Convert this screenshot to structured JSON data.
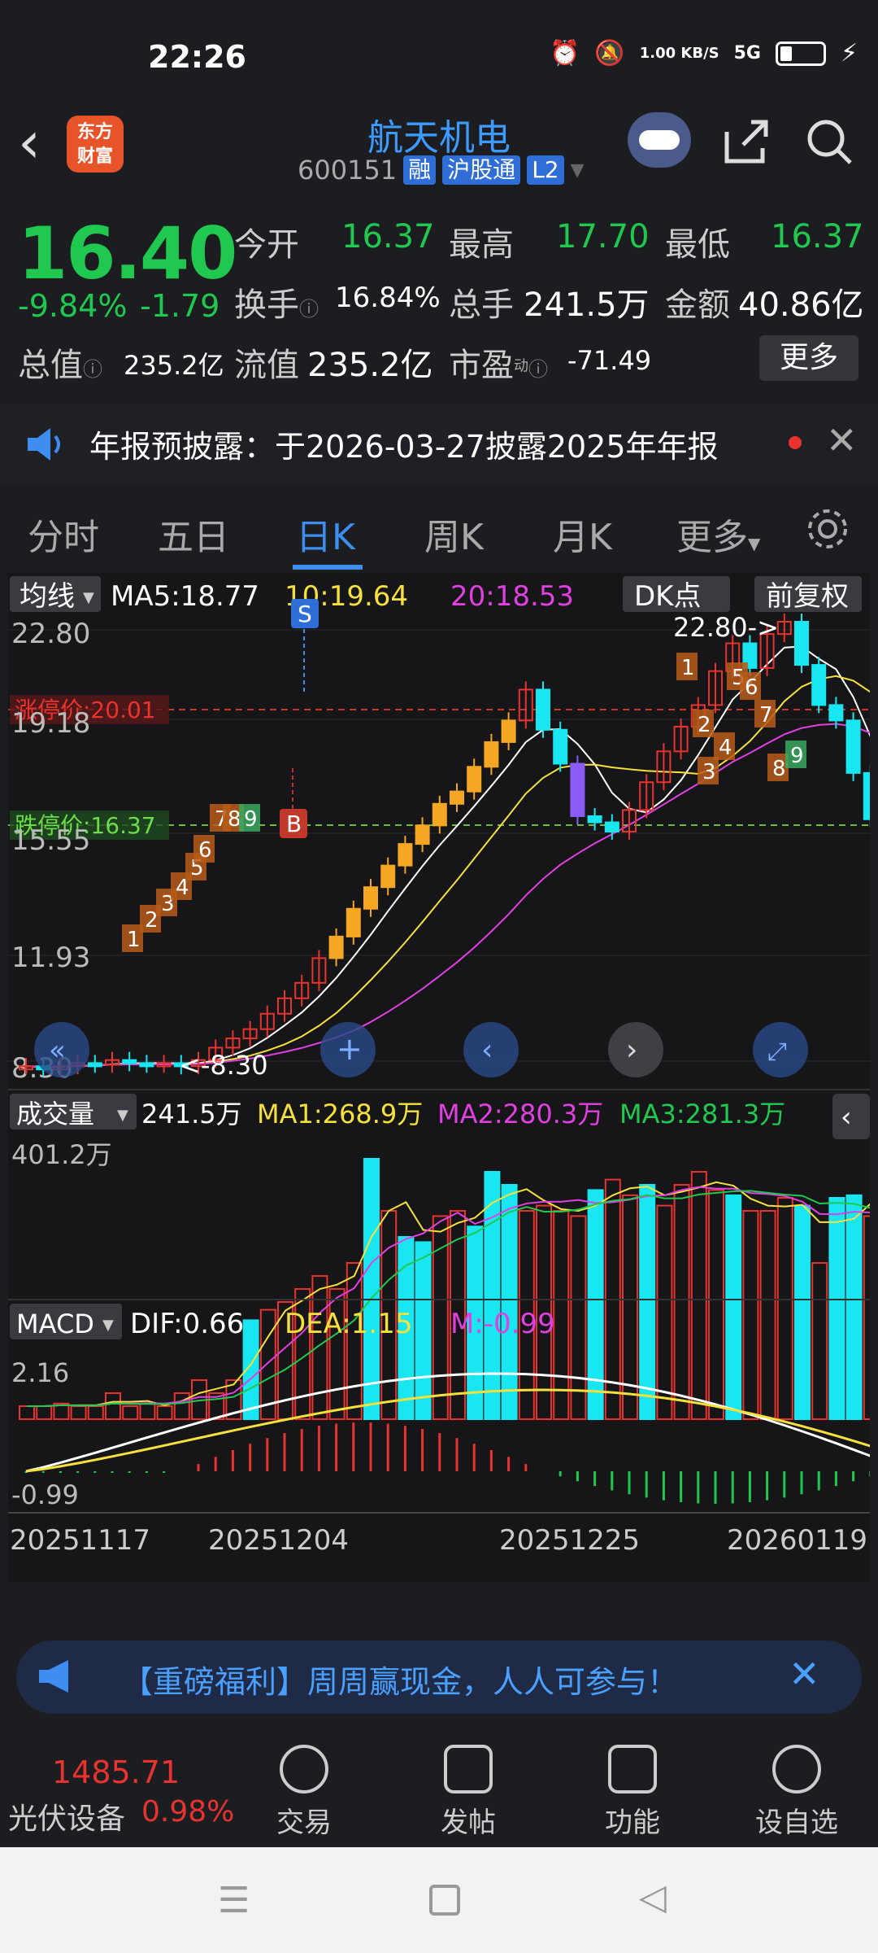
{
  "status_bar": {
    "time": "22:26",
    "net_speed": "1.00 KB/S",
    "signal": "5G"
  },
  "header": {
    "logo_line1": "东方",
    "logo_line2": "财富",
    "stock_name": "航天机电",
    "stock_code": "600151",
    "tag1": "融",
    "tag2": "沪股通",
    "tag3": "L2"
  },
  "quote": {
    "price": "16.40",
    "change_pct": "-9.84%",
    "change": "-1.79",
    "open_label": "今开",
    "open": "16.37",
    "high_label": "最高",
    "high": "17.70",
    "low_label": "最低",
    "low": "16.37",
    "turnover_label": "换手",
    "turnover": "16.84%",
    "volume_label": "总手",
    "volume": "241.5万",
    "amount_label": "金额",
    "amount": "40.86亿",
    "mktcap_label": "总值",
    "mktcap": "235.2亿",
    "float_label": "流值",
    "float": "235.2亿",
    "pe_label": "市盈",
    "pe_sup": "动",
    "pe": "-71.49",
    "more": "更多"
  },
  "notice": {
    "text": "年报预披露：于2026-03-27披露2025年年报"
  },
  "tabs": [
    "分时",
    "五日",
    "日K",
    "周K",
    "月K",
    "更多"
  ],
  "active_tab": "日K",
  "kline": {
    "indicator": "均线",
    "ma5": "MA5:18.77",
    "ma10": "10:19.64",
    "ma20": "20:18.53",
    "dk": "DK点",
    "adjust": "前复权",
    "y_labels": [
      "22.80",
      "19.18",
      "15.55",
      "11.93",
      "8.30"
    ],
    "limit_up": "涨停价:20.01",
    "limit_down": "跌停价:16.37",
    "max_label": "22.80->",
    "min_label": "<-8.30",
    "s_marker": "S",
    "b_marker": "B"
  },
  "volume_panel": {
    "label": "成交量",
    "vol": "241.5万",
    "ma1": "MA1:268.9万",
    "ma2": "MA2:280.3万",
    "ma3": "MA3:281.3万",
    "max": "401.2万"
  },
  "macd_panel": {
    "label": "MACD",
    "dif": "DIF:0.66",
    "dea": "DEA:1.15",
    "m": "M:-0.99",
    "max": "2.16",
    "min": "-0.99"
  },
  "dates": [
    "20251117",
    "20251204",
    "20251225",
    "20260119"
  ],
  "banner": {
    "text": "【重磅福利】周周赢现金，人人可参与！"
  },
  "bottom_nav": {
    "index_value": "1485.71",
    "index_name": "光伏设备",
    "index_pct": "0.98%",
    "trade": "交易",
    "post": "发帖",
    "func": "功能",
    "watch": "设自选"
  },
  "colors": {
    "up": "#e8332e",
    "down": "#20c850",
    "accent": "#3d8ef0",
    "cyan": "#18e6f0"
  }
}
